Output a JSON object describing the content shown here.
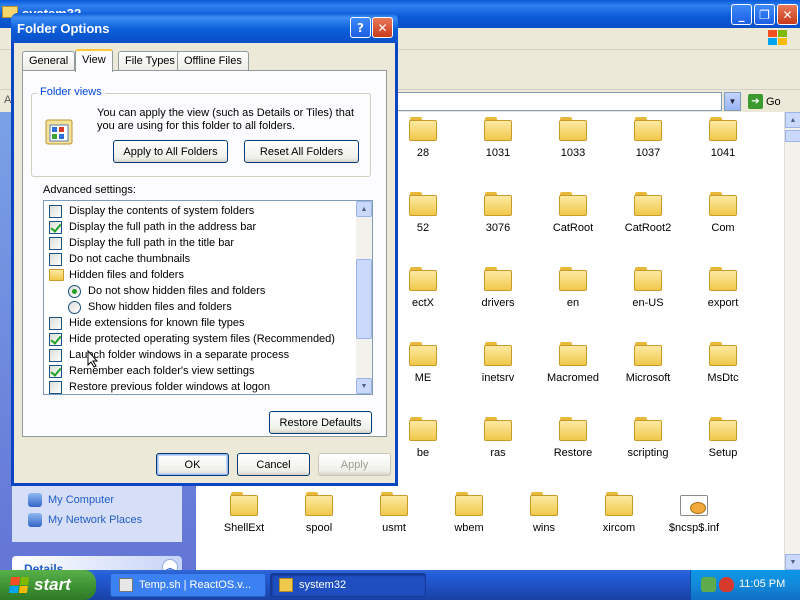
{
  "explorer": {
    "title": "system32",
    "address_label": "A",
    "go_label": "Go",
    "task_links": [
      {
        "label": "My Computer"
      },
      {
        "label": "My Network Places"
      }
    ],
    "details_header": "Details",
    "folders": [
      {
        "label": "28"
      },
      {
        "label": "1031"
      },
      {
        "label": "1033"
      },
      {
        "label": "1037"
      },
      {
        "label": "1041"
      },
      {
        "label": "52"
      },
      {
        "label": "3076"
      },
      {
        "label": "CatRoot"
      },
      {
        "label": "CatRoot2"
      },
      {
        "label": "Com"
      },
      {
        "label": "ectX"
      },
      {
        "label": "drivers"
      },
      {
        "label": "en"
      },
      {
        "label": "en-US"
      },
      {
        "label": "export"
      },
      {
        "label": "ME"
      },
      {
        "label": "inetsrv"
      },
      {
        "label": "Macromed"
      },
      {
        "label": "Microsoft"
      },
      {
        "label": "MsDtc"
      },
      {
        "label": "be"
      },
      {
        "label": "ras"
      },
      {
        "label": "Restore"
      },
      {
        "label": "scripting"
      },
      {
        "label": "Setup"
      },
      {
        "label": "ShellExt"
      },
      {
        "label": "spool"
      },
      {
        "label": "usmt"
      },
      {
        "label": "wbem"
      },
      {
        "label": "wins"
      },
      {
        "label": "xircom"
      },
      {
        "label": "$ncsp$.inf"
      }
    ]
  },
  "dialog": {
    "title": "Folder Options",
    "help_glyph": "?",
    "close_glyph": "✕",
    "tabs": [
      "General",
      "View",
      "File Types",
      "Offline Files"
    ],
    "selected_tab": "View",
    "folder_views_legend": "Folder views",
    "folder_views_text": "You can apply the view (such as Details or Tiles) that you are using for this folder to all folders.",
    "apply_all_label": "Apply to All Folders",
    "reset_all_label": "Reset All Folders",
    "advanced_label": "Advanced settings:",
    "advanced_items": [
      {
        "label": "Display the contents of system folders",
        "control": "checkbox",
        "checked": false
      },
      {
        "label": "Display the full path in the address bar",
        "control": "checkbox",
        "checked": true
      },
      {
        "label": "Display the full path in the title bar",
        "control": "checkbox",
        "checked": false
      },
      {
        "label": "Do not cache thumbnails",
        "control": "checkbox",
        "checked": false
      },
      {
        "label": "Hidden files and folders",
        "control": "folder",
        "checked": false
      },
      {
        "label": "Do not show hidden files and folders",
        "control": "radio",
        "checked": true
      },
      {
        "label": "Show hidden files and folders",
        "control": "radio",
        "checked": false
      },
      {
        "label": "Hide extensions for known file types",
        "control": "checkbox",
        "checked": false
      },
      {
        "label": "Hide protected operating system files (Recommended)",
        "control": "checkbox",
        "checked": true
      },
      {
        "label": "Launch folder windows in a separate process",
        "control": "checkbox",
        "checked": false
      },
      {
        "label": "Remember each folder's view settings",
        "control": "checkbox",
        "checked": true
      },
      {
        "label": "Restore previous folder windows at logon",
        "control": "checkbox",
        "checked": false
      }
    ],
    "restore_defaults_label": "Restore Defaults",
    "ok_label": "OK",
    "cancel_label": "Cancel",
    "apply_label": "Apply"
  },
  "taskbar": {
    "start_label": "start",
    "tasks": [
      {
        "label": "Temp.sh | ReactOS.v...",
        "active": false
      },
      {
        "label": "system32",
        "active": true
      }
    ],
    "clock": "11:05 PM"
  }
}
